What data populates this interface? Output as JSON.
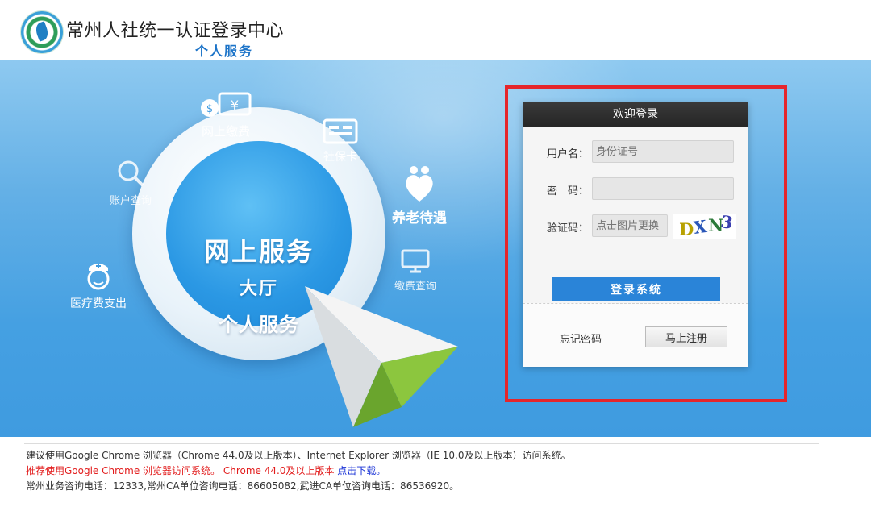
{
  "header": {
    "title": "常州人社统一认证登录中心",
    "subtitle": "个人服务"
  },
  "banner": {
    "circle_main": "网上服务",
    "circle_line2": "大厅",
    "circle_line3": "个人服务",
    "services": {
      "online_payment": "网上缴费",
      "social_card": "社保卡",
      "account_query": "账户查询",
      "pension": "养老待遇",
      "medical": "医疗费支出",
      "payment_query": "缴费查询"
    }
  },
  "login": {
    "header": "欢迎登录",
    "username_label": "用户名：",
    "username_placeholder": "身份证号",
    "password_label": "密　码：",
    "password_placeholder": "",
    "captcha_label": "验证码：",
    "captcha_placeholder": "点击图片更换",
    "captcha_text": "DXN3",
    "login_button": "登录系统",
    "forgot_password": "忘记密码",
    "register_button": "马上注册",
    "highlight_color": "#e5252b"
  },
  "footer": {
    "line1": "建议使用Google Chrome 浏览器（Chrome 44.0及以上版本）、Internet Explorer 浏览器（IE 10.0及以上版本）访问系统。",
    "line2": "推荐使用Google Chrome 浏览器访问系统。 Chrome 44.0及以上版本 ",
    "download_link": "点击下载。",
    "line3": "常州业务咨询电话：12333,常州CA单位咨询电话：86605082,武进CA单位咨询电话：86536920。"
  }
}
